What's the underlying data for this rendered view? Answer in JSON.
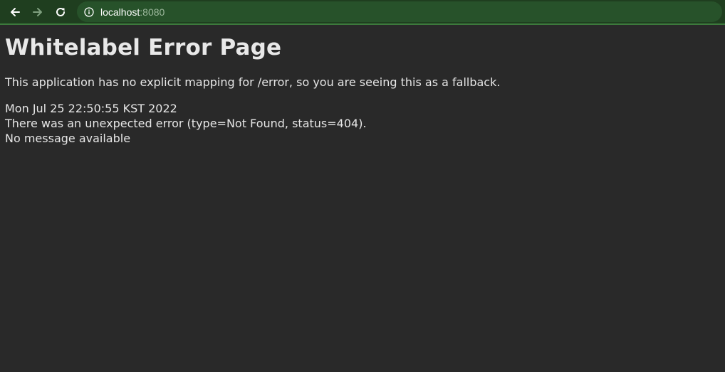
{
  "browser": {
    "url_host": "localhost",
    "url_port": ":8080",
    "icons": {
      "back": "arrow-left-icon",
      "forward": "arrow-right-icon",
      "reload": "reload-icon",
      "site_info": "info-icon"
    },
    "colors": {
      "toolbar": "#1f3e1f",
      "address_bar": "#27522a"
    }
  },
  "page": {
    "title": "Whitelabel Error Page",
    "intro": "This application has no explicit mapping for /error, so you are seeing this as a fallback.",
    "timestamp": "Mon Jul 25 22:50:55 KST 2022",
    "error_line": "There was an unexpected error (type=Not Found, status=404).",
    "message": "No message available",
    "colors": {
      "background": "#292929",
      "text": "#e6e6e6"
    }
  }
}
